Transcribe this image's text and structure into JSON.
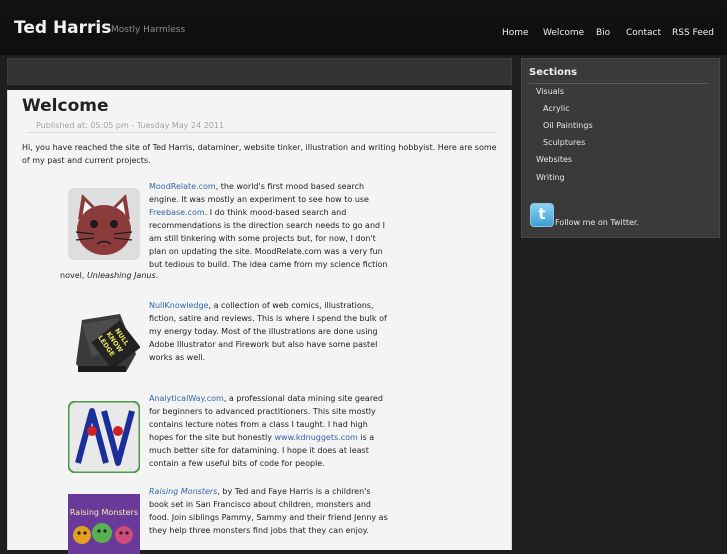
{
  "header": {
    "site_title": "Ted Harris",
    "tagline": "Mostly Harmless",
    "nav": [
      "Home",
      "Welcome",
      "Bio",
      "Contact",
      "RSS Feed"
    ]
  },
  "post": {
    "title": "Welcome",
    "published": "Published at: 05:05 pm - Tuesday May 24 2011",
    "intro": "Hi, you have reached the site of Ted Harris, dataminer, website tinker, illustration and writing hobbyist.  Here are some of my past and current projects."
  },
  "projects": [
    {
      "link_text": "MoodRelate.com",
      "text_1": ", the world's first mood based search engine.  It was mostly an experiment to see how to use ",
      "link2_text": "Freebase.com",
      "text_2": ".  I do think mood-based search and recommendations is the direction search needs to go and I am still tinkering with some projects but, for now, I don't plan on updating the site. MoodRelate.com was a very fun but tedious to build. The idea came from my science fiction",
      "overflow_prefix": "novel, ",
      "overflow_italic": "Unleashing Janus",
      "overflow_suffix": "."
    },
    {
      "link_text": "NullKnowledge",
      "text_1": ", a collection of web comics, illustrations, fiction, satire and reviews. This is where I spend the bulk of my energy today. Most of the illustrations are done using Adobe Illustrator and Firework but also have some pastel works as well."
    },
    {
      "link_text": "AnalyticalWay.com",
      "text_1": ", a professional data mining site geared for beginners to advanced practitioners. This site mostly contains lecture notes from a class I taught. I had high hopes for the site but honestly ",
      "link2_text": "www.kdnuggets.com",
      "text_2": " is a much better site for datamining. I hope it does at least contain a few useful bits of code for people."
    },
    {
      "italic_link_text": "Raising Monsters",
      "text_1": ", by Ted and Faye Harris is a children's book set in San Francisco about children, monsters and food. Join siblings Pammy, Sammy and their friend Jenny as they help three monsters find jobs that they can enjoy.",
      "cover_title": "Raising Monsters"
    }
  ],
  "sidebar": {
    "title": "Sections",
    "items": [
      "Visuals",
      "Acrylic",
      "Oil Paintings",
      "Sculptures",
      "Websites",
      "Writing"
    ],
    "twitter_text": "Follow me on Twitter.",
    "twitter_glyph": "t"
  },
  "images": {
    "null_knowledge_keys": "NULL KNOW LEDGE",
    "analytical_way_logo": "AV"
  },
  "colors": {
    "link": "#3366aa",
    "header_bg": "#121212",
    "content_bg": "#f4f4f4",
    "sidebar_bg": "#3a3a3a"
  },
  "icons": [
    "cat-face-image",
    "typewriter-image",
    "av-logo-image",
    "book-cover-image",
    "twitter-icon"
  ]
}
